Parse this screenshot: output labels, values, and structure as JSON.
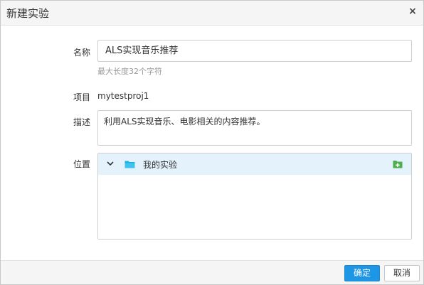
{
  "dialog": {
    "title": "新建实验",
    "close_glyph": "×",
    "close_icon": "close-icon"
  },
  "form": {
    "name_label": "名称",
    "name_value": "ALS实现音乐推荐",
    "name_hint": "最大长度32个字符",
    "project_label": "项目",
    "project_value": "mytestproj1",
    "description_label": "描述",
    "description_value": "利用ALS实现音乐、电影相关的内容推荐。",
    "location_label": "位置"
  },
  "tree": {
    "root_label": "我的实验",
    "expand_icon": "chevron-down-icon",
    "folder_icon": "folder-icon",
    "add_icon": "add-folder-icon"
  },
  "footer": {
    "ok_label": "确定",
    "cancel_label": "取消"
  },
  "colors": {
    "accent": "#1e96e6",
    "folder": "#1ab3e6",
    "add_icon": "#4cae4c",
    "selected_row": "#e4f2fc"
  }
}
